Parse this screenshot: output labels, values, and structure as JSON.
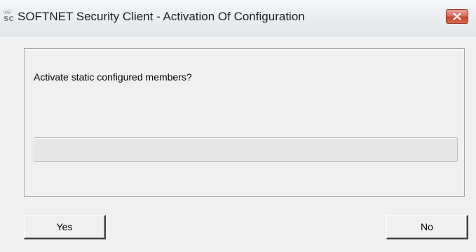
{
  "window": {
    "title": "SOFTNET Security Client - Activation Of Configuration",
    "icon": {
      "name": "softnet-security-client-icon",
      "top_text": "ЧАЙ",
      "bottom_text": "SC"
    },
    "close_icon": "close-icon"
  },
  "dialog": {
    "question": "Activate static configured members?",
    "progress_value": 0
  },
  "buttons": {
    "yes_label": "Yes",
    "no_label": "No"
  },
  "colors": {
    "close_button": "#c9452b",
    "background": "#f0f0f0",
    "progress_fill": "#06b025"
  }
}
